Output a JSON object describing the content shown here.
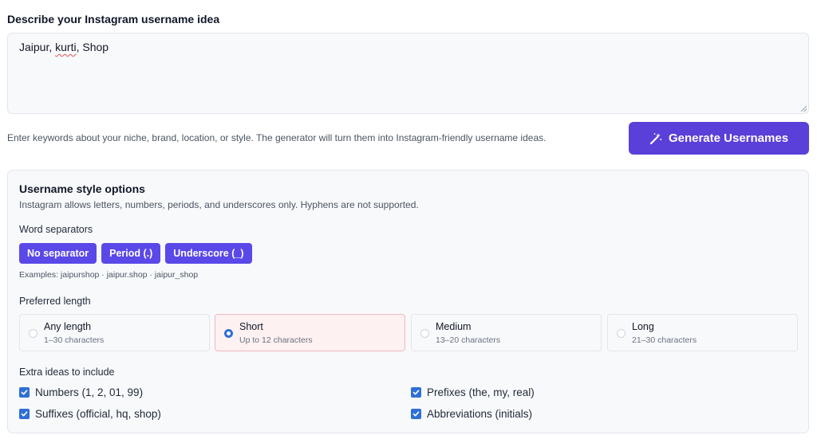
{
  "colors": {
    "primary": "#5b3fd9",
    "chip": "#5b48e8",
    "radio_checked": "#2f6fd6",
    "selected_card_bg": "#fdf1f2",
    "selected_card_border": "#f0b8c0"
  },
  "form": {
    "heading": "Describe your Instagram username idea",
    "input_value_parts": [
      "Jaipur, ",
      "kurti",
      ", Shop"
    ],
    "helper": "Enter keywords about your niche, brand, location, or style. The generator will turn them into Instagram-friendly username ideas.",
    "generate_label": "Generate Usernames",
    "generate_icon": "magic-wand-icon"
  },
  "options": {
    "title": "Username style options",
    "subtitle": "Instagram allows letters, numbers, periods, and underscores only. Hyphens are not supported.",
    "separators_label": "Word separators",
    "separators": [
      "No separator",
      "Period (.)",
      "Underscore (_)"
    ],
    "examples": "Examples: jaipurshop · jaipur.shop · jaipur_shop",
    "length_label": "Preferred length",
    "lengths": [
      {
        "title": "Any length",
        "sub": "1–30 characters",
        "selected": false
      },
      {
        "title": "Short",
        "sub": "Up to 12 characters",
        "selected": true
      },
      {
        "title": "Medium",
        "sub": "13–20 characters",
        "selected": false
      },
      {
        "title": "Long",
        "sub": "21–30 characters",
        "selected": false
      }
    ],
    "extras_label": "Extra ideas to include",
    "extras": [
      {
        "label": "Numbers (1, 2, 01, 99)",
        "checked": true
      },
      {
        "label": "Prefixes (the, my, real)",
        "checked": true
      },
      {
        "label": "Suffixes (official, hq, shop)",
        "checked": true
      },
      {
        "label": "Abbreviations (initials)",
        "checked": true
      }
    ]
  }
}
